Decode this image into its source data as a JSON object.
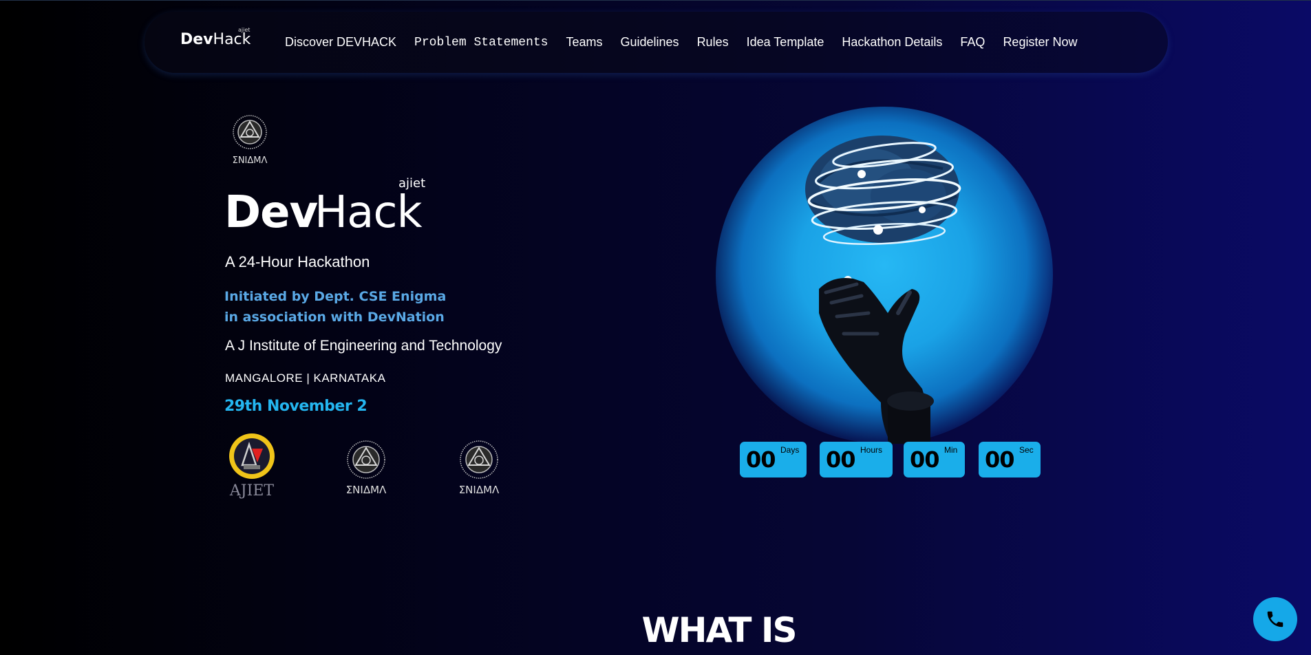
{
  "navbar": {
    "brand": {
      "small": "ajiet",
      "dev": "Dev",
      "hack": "Hack"
    },
    "items": [
      {
        "label": "Discover DEVHACK"
      },
      {
        "label": "Problem Statements"
      },
      {
        "label": "Teams"
      },
      {
        "label": "Guidelines"
      },
      {
        "label": "Rules"
      },
      {
        "label": "Idea Template"
      },
      {
        "label": "Hackathon Details"
      },
      {
        "label": "FAQ"
      },
      {
        "label": "Register Now"
      }
    ]
  },
  "hero": {
    "top_logo_text": "ΣNIΔMΛ",
    "brand": {
      "small": "ajiet",
      "dev": "Dev",
      "hack": "Hack"
    },
    "subtitle": "A 24-Hour Hackathon",
    "initiated_line1": "Initiated by Dept. CSE Enigma",
    "initiated_line2": "in association with DevNation",
    "institute": "A J Institute of Engineering and Technology",
    "location": "MANGALORE | KARNATAKA",
    "date": "29th November 2",
    "logos": [
      {
        "text": "AJIET",
        "icon": "ajiet-logo"
      },
      {
        "text": "ΣNIΔMΛ",
        "icon": "enigma-logo"
      },
      {
        "text": "ΣNIΔMΛ",
        "icon": "enigma-logo"
      }
    ]
  },
  "countdown": [
    {
      "value": "00",
      "unit": "Days"
    },
    {
      "value": "00",
      "unit": "Hours"
    },
    {
      "value": "00",
      "unit": "Min"
    },
    {
      "value": "00",
      "unit": "Sec"
    }
  ],
  "section_heading": "WHAT IS",
  "contact": {
    "icon": "phone-icon"
  },
  "colors": {
    "accent": "#1aaeea",
    "highlight_text": "#5aa9e6",
    "date_text": "#24b6f0",
    "background_end": "#0a0a66"
  }
}
